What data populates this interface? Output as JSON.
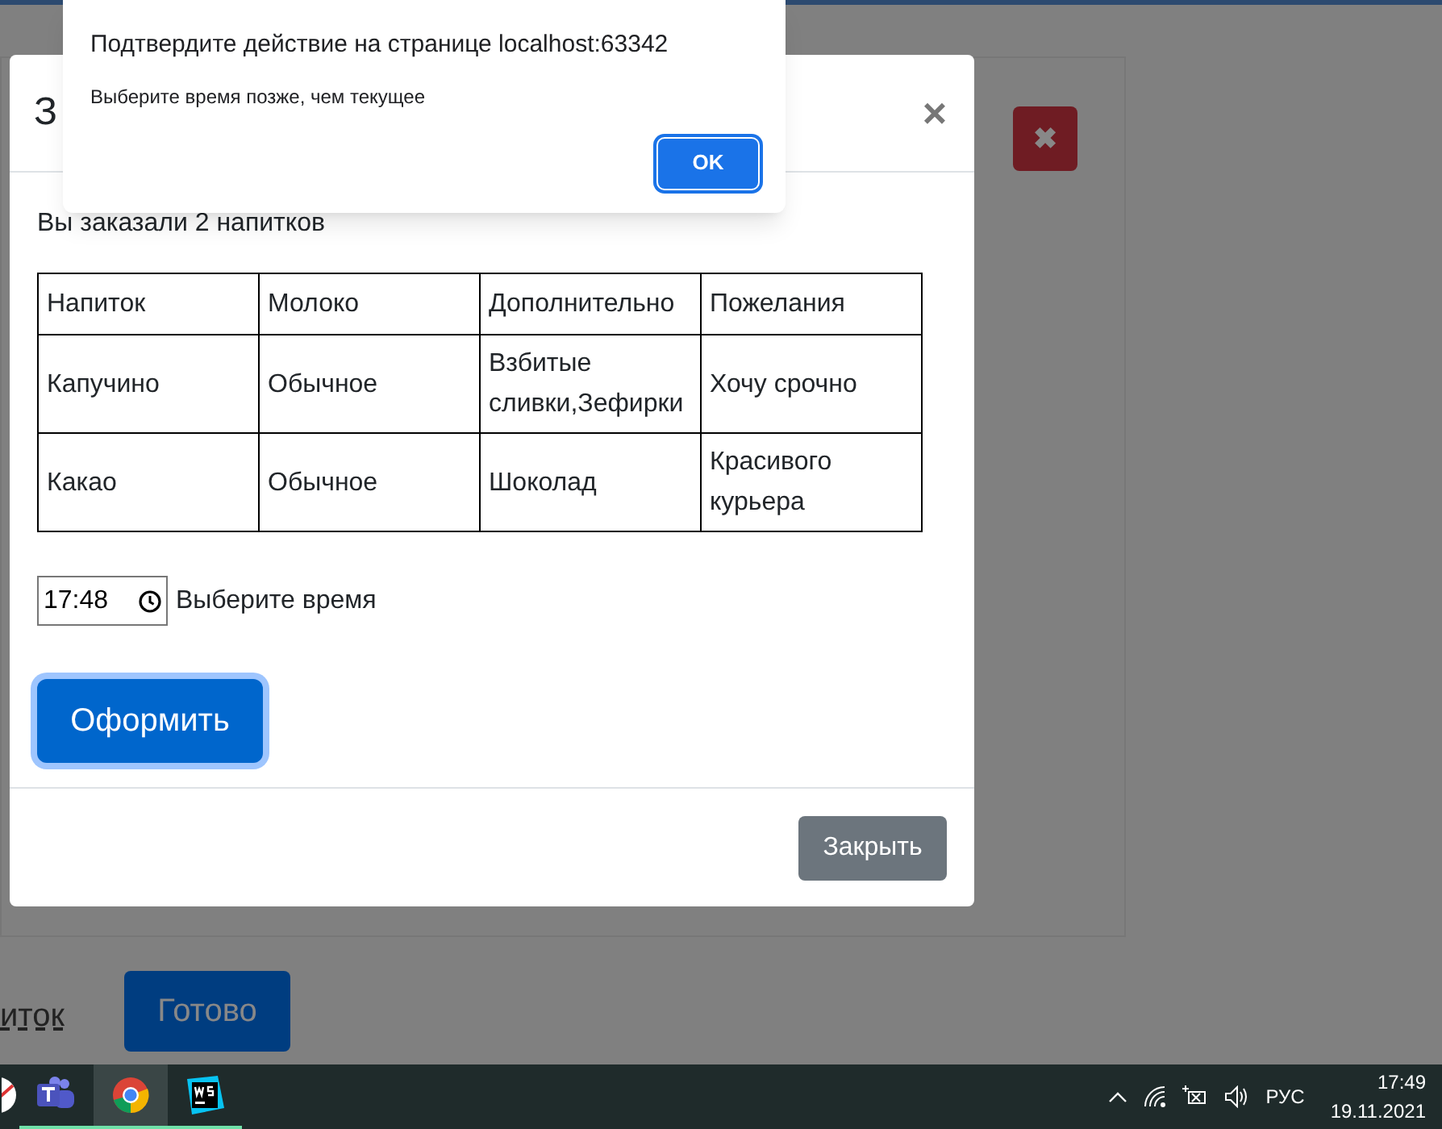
{
  "background_page": {
    "delete_button": "✖",
    "link": "иток",
    "done_button": "Готово"
  },
  "modal": {
    "title": "З",
    "close": "×",
    "summary": "Вы заказали 2 напитков",
    "table": {
      "columns": [
        "Напиток",
        "Молоко",
        "Дополнительно",
        "Пожелания"
      ],
      "rows": [
        [
          "Капучино",
          "Обычное",
          "Взбитые сливки,Зефирки",
          "Хочу срочно"
        ],
        [
          "Какао",
          "Обычное",
          "Шоколад",
          "Красивого курьера"
        ]
      ]
    },
    "time_field": {
      "value": "17:48"
    },
    "time_label": "Выберите время",
    "submit": "Оформить",
    "footer_button": "Закрыть"
  },
  "alert": {
    "title": "Подтвердите действие на странице localhost:63342",
    "message": "Выберите время позже, чем текущее",
    "ok": "OK"
  },
  "taskbar": {
    "apps": [
      {
        "kind": "red",
        "selected": false
      },
      {
        "kind": "teams",
        "selected": false
      },
      {
        "kind": "chrome",
        "selected": true
      },
      {
        "kind": "webstorm",
        "selected": false
      }
    ],
    "language": "РУС",
    "time": "17:49",
    "date": "19.11.2021"
  }
}
